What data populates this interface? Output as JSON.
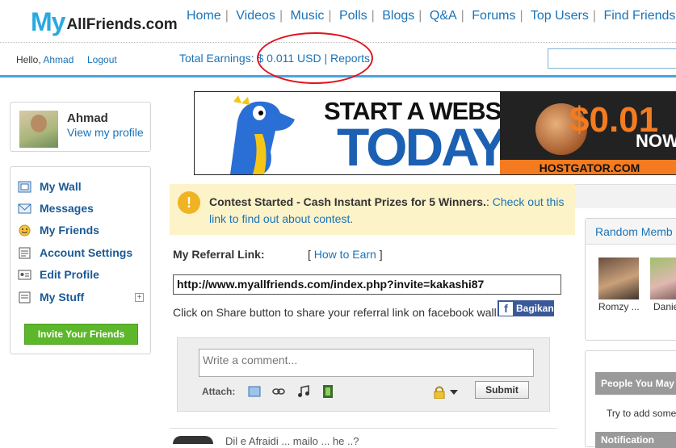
{
  "logo": {
    "my": "My",
    "rest": "AllFriends.com"
  },
  "nav": [
    "Home",
    "Videos",
    "Music",
    "Polls",
    "Blogs",
    "Q&A",
    "Forums",
    "Top Users",
    "Find Friends"
  ],
  "userbar": {
    "hello": "Hello,",
    "username": "Ahmad",
    "logout": "Logout",
    "earnings": "Total Earnings: $ 0.011 USD | Reports"
  },
  "profile": {
    "name": "Ahmad",
    "view_link": "View my profile"
  },
  "menu": [
    "My Wall",
    "Messages",
    "My Friends",
    "Account Settings",
    "Edit Profile",
    "My Stuff"
  ],
  "invite_button": "Invite Your Friends",
  "banner": {
    "line1": "START A WEBSITE",
    "line2": "TODAY",
    "price": "$0.01",
    "now": "NOW",
    "domain": "HOSTGATOR.COM"
  },
  "contest": {
    "title": "Contest Started - Cash Instant Prizes for 5 Winners.",
    "colon": ":",
    "link_text": "Check out this link to find out about contest."
  },
  "referral": {
    "label": "My Referral Link:",
    "how_to_open": "[",
    "how_to": "How to Earn",
    "how_to_close": "]",
    "url": "http://www.myallfriends.com/index.php?invite=kakashi87",
    "share_text": "Click on Share button to share your referral link on facebook wall",
    "share_button": "Bagikan"
  },
  "composer": {
    "placeholder": "Write a comment...",
    "attach_label": "Attach:",
    "submit": "Submit"
  },
  "feed": {
    "first_item_text": "Dil e Afraidi ... mailo ... he ..?"
  },
  "random_members": {
    "title": "Random Memb",
    "members": [
      "Romzy ...",
      "Danie"
    ]
  },
  "people_you_may": {
    "title": "People You May",
    "text": "Try to add some",
    "notifications": "Notification"
  },
  "colors": {
    "accent": "#1a73b8",
    "invite_green": "#5cb82a",
    "contest_bg": "#fcf3c8",
    "annotation_circle": "#e0141e"
  },
  "icons": [
    "wall-icon",
    "messages-icon",
    "friends-icon",
    "settings-icon",
    "edit-profile-icon",
    "stuff-icon",
    "info-icon",
    "image-icon",
    "link-icon",
    "music-icon",
    "video-icon",
    "lock-icon",
    "facebook-icon"
  ]
}
